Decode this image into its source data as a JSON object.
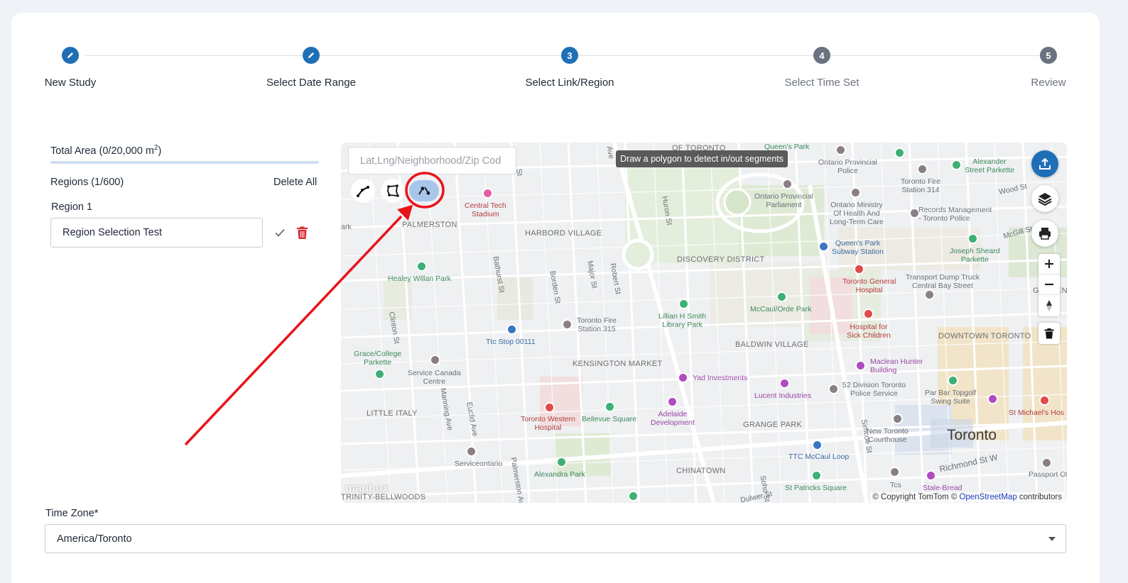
{
  "stepper": {
    "steps": [
      {
        "label": "New Study",
        "state": "done",
        "icon": "pencil-icon"
      },
      {
        "label": "Select Date Range",
        "state": "done",
        "icon": "pencil-icon"
      },
      {
        "label": "Select Link/Region",
        "state": "active",
        "number": "3"
      },
      {
        "label": "Select Time Set",
        "state": "todo",
        "number": "4"
      },
      {
        "label": "Review",
        "state": "todo",
        "number": "5"
      }
    ]
  },
  "left_panel": {
    "total_area_prefix": "Total Area (0/20,000 m",
    "total_area_sup": "2",
    "total_area_suffix": ")",
    "total_area_fraction": 0,
    "regions_title": "Regions (1/600)",
    "delete_all": "Delete All",
    "region_label": "Region 1",
    "region_value": "Region Selection Test"
  },
  "map": {
    "search_placeholder": "Lat,Lng/Neighborhood/Zip Cod",
    "tooltip": "Draw a polygon to detect in/out segments",
    "copyright_prefix": "© Copyright TomTom © ",
    "copyright_link": "OpenStreetMap",
    "copyright_suffix": " contributors",
    "logo": "mapbox",
    "labels": {
      "of_toronto": "OF TORONTO",
      "queens_park": "Queen's Park",
      "ontario_provincial_police": "Ontario Provincial\nPolice",
      "toronto_fire_314": "Toronto Fire\nStation 314",
      "alexander_parkette": "Alexander\nStreet Parkette",
      "wood_st": "Wood St",
      "central_tech": "Central Tech\nStadium",
      "harbord_village": "HARBORD VILLAGE",
      "palmerston": "PALMERSTON",
      "ontario_parliament": "Ontario Provincial\nParliament",
      "ontario_ministry": "Ontario Ministry\nOf Health And\nLong-Term Care",
      "records_management": "Records Management\n- Toronto Police",
      "mcgill_st": "McGill St",
      "joseph_sheard": "Joseph Sheard\nParkette",
      "queens_park_station": "Queen's Park\nSubway Station",
      "discovery_district": "DISCOVERY DISTRICT",
      "healey_willan": "Healey Willan Park",
      "bathurst_st": "Bathurst St",
      "borden_st": "Borden St",
      "major_st": "Major St",
      "robert_st": "Robert St",
      "huron_st": "Huron St",
      "toronto_general": "Toronto General\nHospital",
      "transport_dump": "Transport Dump Truck\nCentral Bay Street",
      "garden": "GARDEN",
      "mccaul_orde": "McCaul/Orde Park",
      "lillian_smith": "Lillian H Smith\nLibrary Park",
      "toronto_fire_315": "Toronto Fire\nStation 315",
      "hospital_sick_children": "Hospital for\nSick Children",
      "clinton_st": "Clinton St",
      "ttc_stop": "Ttc Stop 00111",
      "baldwin_village": "BALDWIN VILLAGE",
      "downtown_toronto": "DOWNTOWN TORONTO",
      "grace_college": "Grace/College\nParkette",
      "service_canada": "Service Canada\nCentre",
      "kensington_market": "KENSINGTON MARKET",
      "yad_investments": "Yad Investments",
      "maclean_hunter": "Maclean Hunter\nBuilding",
      "division_52": "52 Division Toronto\nPolice Service",
      "lucent": "Lucent Industries",
      "par_bar": "Par Bar Topgolf\nSwing Suite",
      "little_italy": "LITTLE ITALY",
      "manning_ave": "Manning Ave",
      "euclid_ave": "Euclid Ave",
      "toronto_western": "Toronto Western\nHospital",
      "bellevue_square": "Bellevue Square",
      "adelaide_dev": "Adelaide\nDevelopment",
      "grange_park": "GRANGE PARK",
      "simcoe_st": "Simcoe St",
      "new_toronto_courthouse": "New Toronto\nCourthouse",
      "toronto": "Toronto",
      "st_michaels": "St Michael's Hos",
      "serviceontario": "Serviceontario",
      "palmerston_ave": "Palmerston Ave",
      "ttc_mccaul": "TTC McCaul Loop",
      "richmond_st": "Richmond St W",
      "passport": "Passport Offi",
      "alexandra_park": "Alexandra Park",
      "chinatown": "CHINATOWN",
      "st_patricks": "St Patricks Square",
      "tcs": "Tcs",
      "stale_bread": "Stale-Bread",
      "trinity_bellwoods": "TRINITY-BELLWOODS",
      "dulwer_st": "Dulwer St",
      "soho_st": "Soho St",
      "ark": "ark",
      "ave": "Ave",
      "st_fragment": "St"
    }
  },
  "timezone": {
    "label": "Time Zone*",
    "value": "America/Toronto"
  },
  "colors": {
    "primary": "#1f6fb6",
    "annotation": "#e8141b",
    "delete": "#d9262b"
  }
}
